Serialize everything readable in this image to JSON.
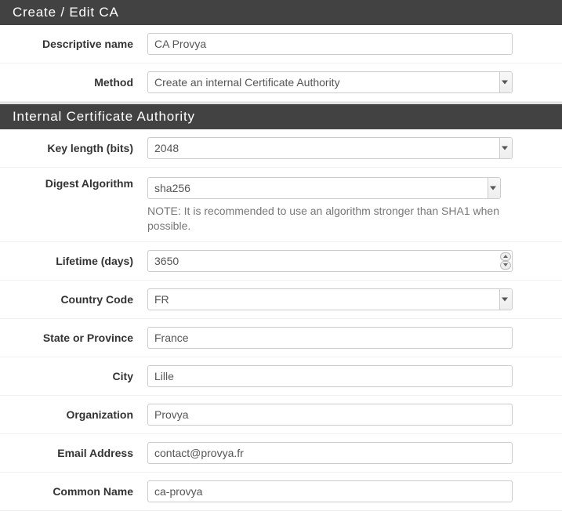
{
  "section1": {
    "header": "Create / Edit CA",
    "descriptive_name": {
      "label": "Descriptive name",
      "value": "CA Provya"
    },
    "method": {
      "label": "Method",
      "value": "Create an internal Certificate Authority"
    }
  },
  "section2": {
    "header": "Internal Certificate Authority",
    "key_length": {
      "label": "Key length (bits)",
      "value": "2048"
    },
    "digest_algorithm": {
      "label": "Digest Algorithm",
      "value": "sha256",
      "note": "NOTE: It is recommended to use an algorithm stronger than SHA1 when possible."
    },
    "lifetime": {
      "label": "Lifetime (days)",
      "value": "3650"
    },
    "country_code": {
      "label": "Country Code",
      "value": "FR"
    },
    "state_or_province": {
      "label": "State or Province",
      "value": "France"
    },
    "city": {
      "label": "City",
      "value": "Lille"
    },
    "organization": {
      "label": "Organization",
      "value": "Provya"
    },
    "email_address": {
      "label": "Email Address",
      "value": "contact@provya.fr"
    },
    "common_name": {
      "label": "Common Name",
      "value": "ca-provya"
    }
  }
}
